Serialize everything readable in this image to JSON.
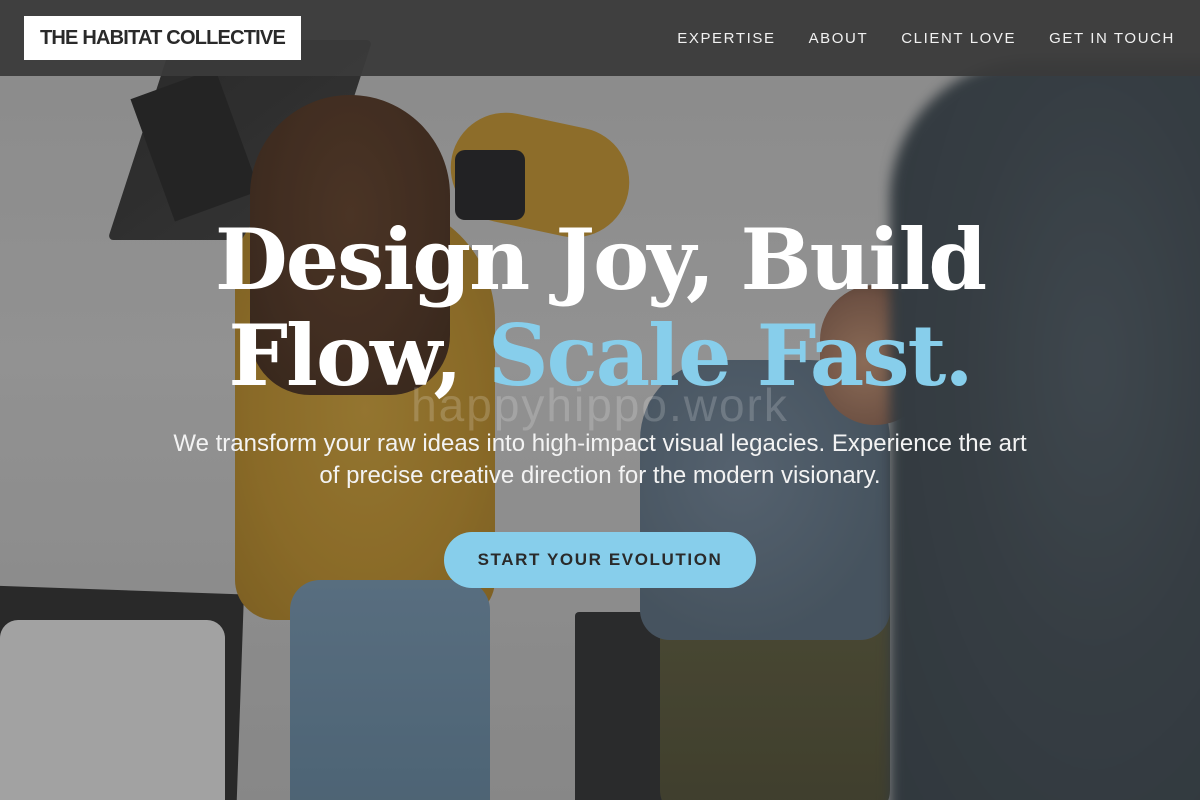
{
  "brand": {
    "logo_text": "THE HABITAT COLLECTIVE"
  },
  "nav": {
    "items": [
      {
        "label": "EXPERTISE"
      },
      {
        "label": "ABOUT"
      },
      {
        "label": "CLIENT LOVE"
      },
      {
        "label": "GET IN TOUCH"
      }
    ]
  },
  "hero": {
    "headline_line1": "Design Joy, Build",
    "headline_line2_plain": "Flow,",
    "headline_line2_accent": "Scale Fast.",
    "subtitle": "We transform your raw ideas into high-impact visual legacies. Experience the art of precise creative direction for the modern visionary.",
    "cta_label": "START YOUR EVOLUTION",
    "watermark": "happyhippo.work",
    "background": "photo of a photographer in a yellow sweater shooting a seated man in a denim jacket in a studio"
  },
  "colors": {
    "accent": "#87CEEB",
    "navbar": "#3A3A3A",
    "text_light": "#FFFFFF",
    "text_dark": "#2A2A2A"
  }
}
